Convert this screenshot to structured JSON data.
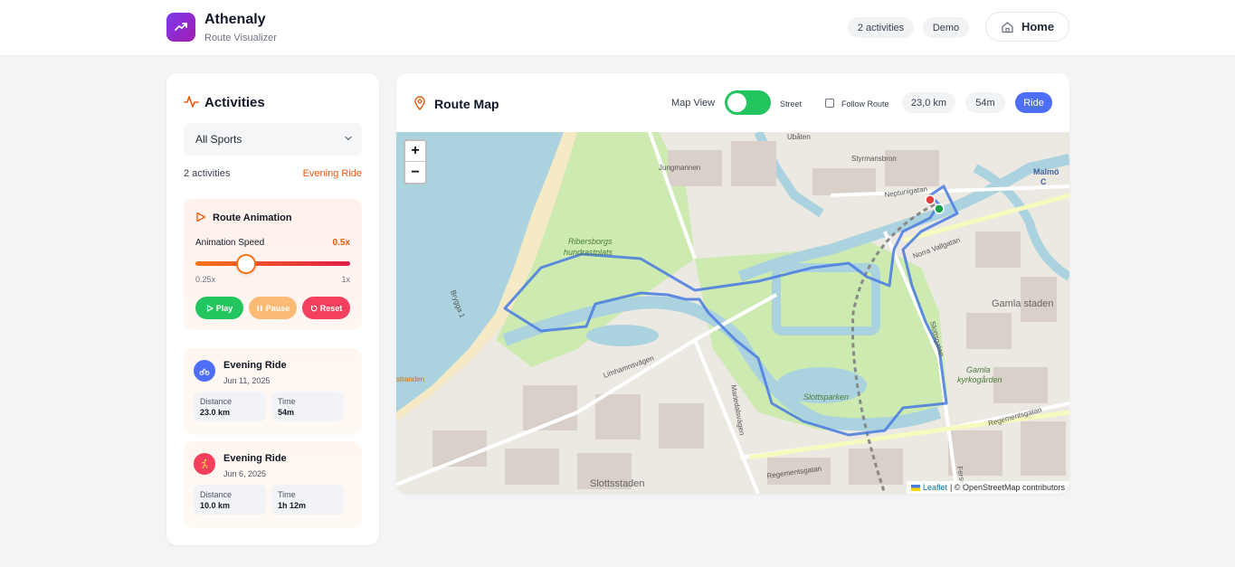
{
  "header": {
    "app_name": "Athenaly",
    "app_subtitle": "Route Visualizer",
    "activities_badge": "2 activities",
    "demo_badge": "Demo",
    "home_label": "Home"
  },
  "sidebar": {
    "title": "Activities",
    "sport_filter": "All Sports",
    "count_text": "2 activities",
    "selected_activity": "Evening Ride",
    "animation": {
      "title": "Route Animation",
      "speed_label": "Animation Speed",
      "speed_value": "0.5x",
      "speed_fraction": 0.33,
      "min_label": "0.25x",
      "max_label": "1x",
      "play_label": "Play",
      "pause_label": "Pause",
      "reset_label": "Reset"
    },
    "activities": [
      {
        "name": "Evening Ride",
        "date": "Jun 11, 2025",
        "distance_label": "Distance",
        "distance": "23.0 km",
        "time_label": "Time",
        "time": "54m",
        "avatar_color": "#4f6ef7"
      },
      {
        "name": "Evening Ride",
        "date": "Jun 6, 2025",
        "distance_label": "Distance",
        "distance": "10.0 km",
        "time_label": "Time",
        "time": "1h 12m",
        "avatar_color": "#f43f5e"
      }
    ]
  },
  "map_panel": {
    "title": "Route Map",
    "map_view_label": "Map View",
    "street_label": "Street",
    "follow_label": "Follow Route",
    "distance_badge": "23,0 km",
    "time_badge": "54m",
    "type_badge": "Ride",
    "zoom_in": "+",
    "zoom_out": "−",
    "attribution_link": "Leaflet",
    "attribution_text": "| © OpenStreetMap contributors",
    "labels": {
      "park": "Ribersborgs hundrastplats",
      "park_l1": "Ribersborgs",
      "park_l2": "hundrastplats",
      "slottsparken": "Slottsparken",
      "gamla_staden": "Gamla staden",
      "gamla_kyrk_1": "Gamla",
      "gamla_kyrk_2": "kyrkogården",
      "slottsstaden": "Slottsstaden",
      "ubaten": "Ubåten",
      "styrmansbron": "Styrmansbron",
      "malmo": "Malmö",
      "malmo_c": "C",
      "jungmannen": "Jungmannen",
      "limhamnsvagen": "Limhamnsvägen",
      "regementsgatan": "Regementsgatan",
      "regementsgatan2": "Regementsgatan",
      "norra_vallgatan": "Norra Vallgatan",
      "mariedalsvagen": "Mariedalsvägen",
      "slottsgatan": "Slottsgatan",
      "neptunigatan": "Neptunigatan",
      "bryggan": "Brygga 1",
      "stranden": "stranden",
      "fersens": "Fersens"
    }
  },
  "colors": {
    "accent": "#4f6ef7",
    "orange": "#ea580c",
    "play": "#22c55e",
    "pause": "#fdba74",
    "reset": "#f43f5e",
    "route": "#4f7fe0"
  },
  "icons": {
    "logo": "trending-up-icon",
    "home": "home-icon",
    "activity": "activity-pulse-icon",
    "map": "map-pin-icon",
    "chevron": "chevron-down-icon",
    "play": "play-icon"
  }
}
